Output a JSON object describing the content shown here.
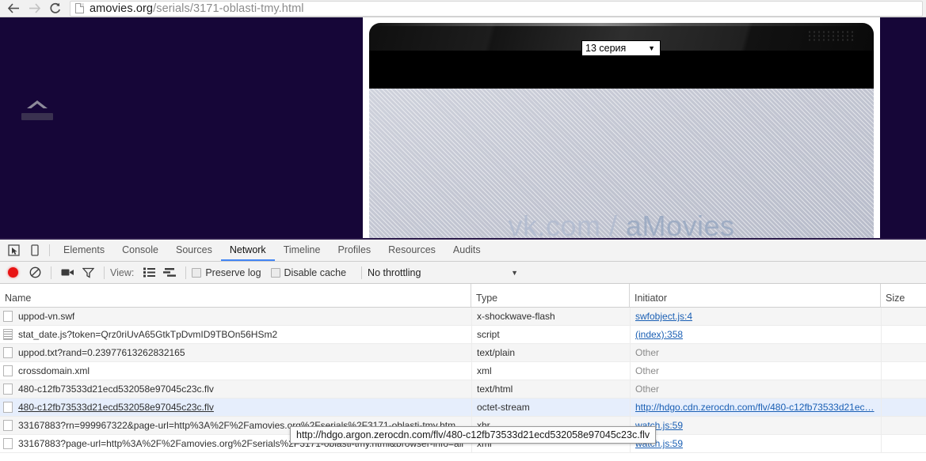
{
  "browser": {
    "back_label": "back-arrow",
    "forward_label": "forward-arrow",
    "reload_label": "reload",
    "url_host": "amovies.org",
    "url_path": "/serials/3171-oblasti-tmy.html",
    "url_full": "amovies.org/serials/3171-oblasti-tmy.html"
  },
  "page": {
    "background_color": "#160638",
    "logo_name": "amovies-logo",
    "player": {
      "watermark_prefix": "vk.com / ",
      "watermark_brand": "aMovies",
      "episode_select_value": "13 серия",
      "episode_select_arrow": "▼"
    }
  },
  "devtools": {
    "tabs": [
      {
        "label": "Elements",
        "active": false
      },
      {
        "label": "Console",
        "active": false
      },
      {
        "label": "Sources",
        "active": false
      },
      {
        "label": "Network",
        "active": true
      },
      {
        "label": "Timeline",
        "active": false
      },
      {
        "label": "Profiles",
        "active": false
      },
      {
        "label": "Resources",
        "active": false
      },
      {
        "label": "Audits",
        "active": false
      }
    ],
    "accent_color": "#4285f4",
    "toolbar": {
      "record_label": "record",
      "clear_label": "clear",
      "capture_screenshots_label": "capture-screenshots",
      "filter_label": "filter",
      "view_label": "View:",
      "view_list_label": "list-view",
      "view_waterfall_label": "waterfall-view",
      "preserve_log_label": "Preserve log",
      "preserve_log_checked": false,
      "disable_cache_label": "Disable cache",
      "disable_cache_checked": false,
      "throttling_value": "No throttling",
      "throttling_arrow": "▼"
    },
    "table": {
      "columns": [
        "Name",
        "Type",
        "Initiator",
        "Size"
      ],
      "rows": [
        {
          "name": "uppod-vn.swf",
          "icon": "plain",
          "type": "x-shockwave-flash",
          "initiator": "swfobject.js:4",
          "initiator_kind": "link",
          "size": "",
          "selected": false
        },
        {
          "name": "stat_date.js?token=Qrz0riUvA65GtkTpDvmID9TBOn56HSm2",
          "icon": "script",
          "type": "script",
          "initiator": "(index):358",
          "initiator_kind": "link",
          "size": "",
          "selected": false
        },
        {
          "name": "uppod.txt?rand=0.23977613262832165",
          "icon": "plain",
          "type": "text/plain",
          "initiator": "Other",
          "initiator_kind": "other",
          "size": "",
          "selected": false
        },
        {
          "name": "crossdomain.xml",
          "icon": "plain",
          "type": "xml",
          "initiator": "Other",
          "initiator_kind": "other",
          "size": "",
          "selected": false
        },
        {
          "name": "480-c12fb73533d21ecd532058e97045c23c.flv",
          "icon": "plain",
          "type": "text/html",
          "initiator": "Other",
          "initiator_kind": "other",
          "size": "",
          "selected": false
        },
        {
          "name": "480-c12fb73533d21ecd532058e97045c23c.flv",
          "icon": "plain",
          "type": "octet-stream",
          "initiator": "http://hdgo.cdn.zerocdn.com/flv/480-c12fb73533d21ec…",
          "initiator_kind": "link",
          "size": "",
          "selected": true
        },
        {
          "name": "33167883?rn=999967322&page-url=http%3A%2F%2Famovies.org%2Fserials%2F3171-oblasti-tmy.html&…",
          "icon": "plain",
          "type": "xhr",
          "initiator": "watch.js:59",
          "initiator_kind": "link",
          "size": "",
          "selected": false
        },
        {
          "name": "33167883?page-url=http%3A%2F%2Famovies.org%2Fserials%2F3171-oblasti-tmy.html&browser-info=all",
          "icon": "plain",
          "type": "xml",
          "initiator": "watch.js:59",
          "initiator_kind": "link",
          "size": "",
          "selected": false
        }
      ]
    },
    "tooltip": {
      "text": "http://hdgo.argon.zerocdn.com/flv/480-c12fb73533d21ecd532058e97045c23c.flv"
    }
  }
}
